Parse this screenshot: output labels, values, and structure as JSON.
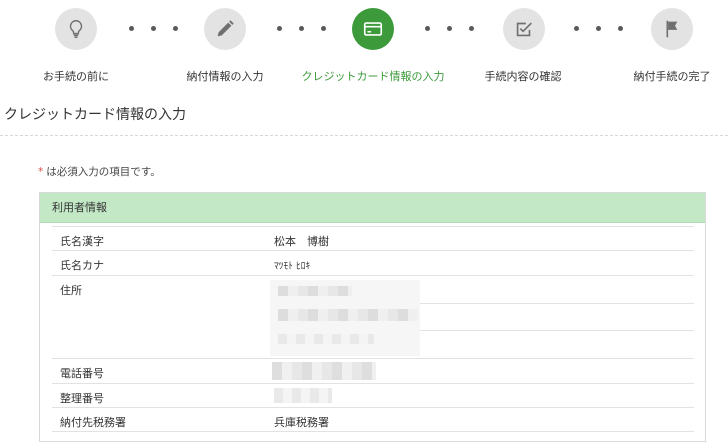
{
  "stepper": {
    "steps": [
      {
        "label": "お手続の前に",
        "icon": "lightbulb-icon",
        "state": "inactive"
      },
      {
        "label": "納付情報の入力",
        "icon": "pencil-icon",
        "state": "inactive"
      },
      {
        "label": "クレジットカード情報の入力",
        "icon": "credit-card-icon",
        "state": "active"
      },
      {
        "label": "手続内容の確認",
        "icon": "checklist-icon",
        "state": "inactive"
      },
      {
        "label": "納付手続の完了",
        "icon": "flag-icon",
        "state": "inactive"
      }
    ]
  },
  "page": {
    "title": "クレジットカード情報の入力"
  },
  "required_note": {
    "star": "*",
    "text": "は必須入力の項目です。"
  },
  "panel": {
    "header": "利用者情報",
    "rows": [
      {
        "label": "氏名漢字",
        "value": "松本　博樹"
      },
      {
        "label": "氏名カナ",
        "value": "ﾏﾂﾓﾄ ﾋﾛｷ"
      },
      {
        "label": "住所",
        "value": ""
      },
      {
        "label": "電話番号",
        "value": ""
      },
      {
        "label": "整理番号",
        "value": ""
      },
      {
        "label": "納付先税務署",
        "value": "兵庫税務署"
      }
    ]
  },
  "colors": {
    "accent": "#3c9a3a",
    "panel_header_bg": "#c3e8c5",
    "inactive_circle": "#e3e3e3",
    "required_star": "#d9534f"
  }
}
